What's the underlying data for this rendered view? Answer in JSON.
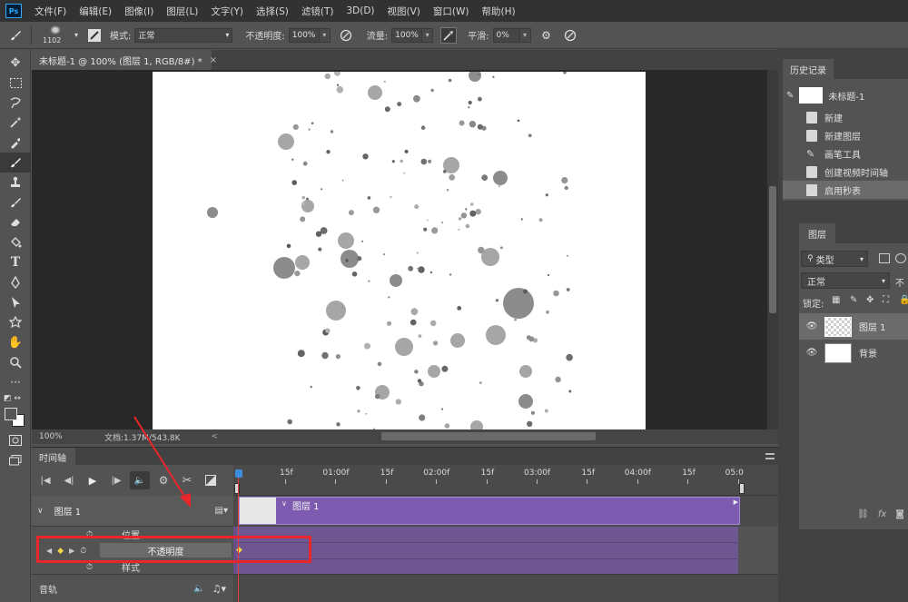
{
  "menu": {
    "logo": "Ps",
    "items": [
      "文件(F)",
      "编辑(E)",
      "图像(I)",
      "图层(L)",
      "文字(Y)",
      "选择(S)",
      "滤镜(T)",
      "3D(D)",
      "视图(V)",
      "窗口(W)",
      "帮助(H)"
    ]
  },
  "options": {
    "brush_size": "1102",
    "mode_label": "模式:",
    "mode_value": "正常",
    "opacity_label": "不透明度:",
    "opacity_value": "100%",
    "flow_label": "流量:",
    "flow_value": "100%",
    "smooth_label": "平滑:",
    "smooth_value": "0%"
  },
  "document": {
    "tab_title": "未标题-1 @ 100% (图层 1, RGB/8#) *",
    "close": "×",
    "zoom": "100%",
    "doc_info": "文档:1.37M/543.8K",
    "arrow": "<"
  },
  "timeline": {
    "tab": "时间轴",
    "ticks": [
      "15f",
      "01:00f",
      "15f",
      "02:00f",
      "15f",
      "03:00f",
      "15f",
      "04:00f",
      "15f",
      "05:0"
    ],
    "playhead_frame": 0,
    "layer_name": "图层 1",
    "clip_label": "图层 1",
    "properties": [
      "位置",
      "不透明度",
      "样式"
    ],
    "audio_label": "音轨"
  },
  "history": {
    "tab": "历史记录",
    "snapshot": "未标题-1",
    "items": [
      "新建",
      "新建图层",
      "画笔工具",
      "创建视频时间轴",
      "启用秒表"
    ]
  },
  "layers": {
    "tab": "图层",
    "filter_value": "类型",
    "blend_value": "正常",
    "opacity_short": "不",
    "lock_label": "锁定:",
    "rows": [
      {
        "name": "图层 1",
        "thumb": "transparent"
      },
      {
        "name": "背景",
        "thumb": "white"
      }
    ],
    "fx": "fx"
  },
  "colors": {
    "clip": "#7d5bb0",
    "highlight": "#e8262b",
    "playhead": "#e23d3d"
  }
}
